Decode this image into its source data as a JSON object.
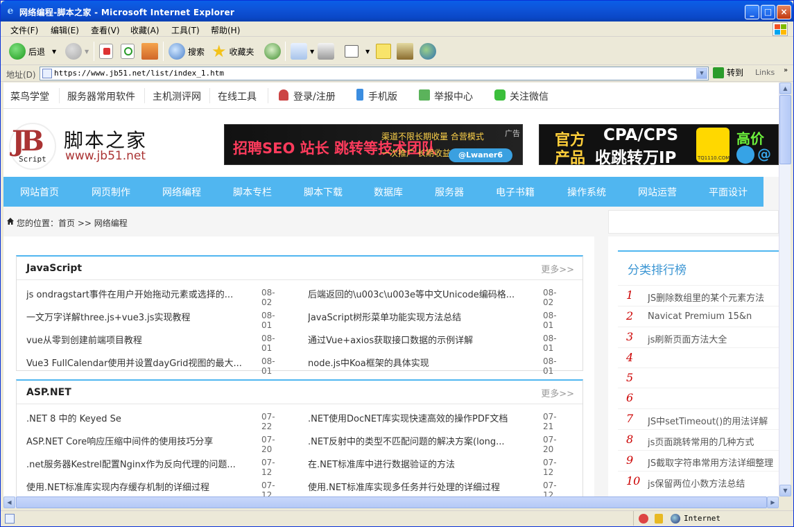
{
  "window": {
    "title": "网络编程-脚本之家 - Microsoft Internet Explorer"
  },
  "menu": [
    "文件(F)",
    "编辑(E)",
    "查看(V)",
    "收藏(A)",
    "工具(T)",
    "帮助(H)"
  ],
  "toolbar": {
    "back": "后退",
    "search": "搜索",
    "favorites": "收藏夹"
  },
  "address": {
    "label": "地址(D)",
    "url": "https://www.jb51.net/list/index_1.htm",
    "go": "转到",
    "links": "Links"
  },
  "status": {
    "zone": "Internet"
  },
  "page": {
    "topnav": [
      "菜鸟学堂",
      "服务器常用软件",
      "主机测评网",
      "在线工具",
      "登录/注册",
      "手机版",
      "举报中心",
      "关注微信"
    ],
    "logo": {
      "cn": "脚本之家",
      "url": "www.jb51.net",
      "mark": "JB",
      "script": "Script"
    },
    "ad1": {
      "headline": "招聘SEO 站长 跳转等技术团队",
      "line1": "渠道不限长期收量 合营模式",
      "line2": "一次推广 长期收益",
      "tag": "广告",
      "handle": "@Lwaner6"
    },
    "ad2": {
      "word1": "官方",
      "word2": "产品",
      "cpa": "CPA/CPS",
      "ip": "收跳转万IP",
      "brand": "TQ1110.COM",
      "high": "高价",
      "at": "@"
    },
    "mainnav": [
      "网站首页",
      "网页制作",
      "网络编程",
      "脚本专栏",
      "脚本下载",
      "数据库",
      "服务器",
      "电子书籍",
      "操作系统",
      "网站运营",
      "平面设计"
    ],
    "breadcrumb": "您的位置：首页 >> 网络编程",
    "panels": [
      {
        "title": "JavaScript",
        "more": "更多>>",
        "rows": [
          [
            "js ondragstart事件在用户开始拖动元素或选择的...",
            "08-02",
            "后端返回的\\u003c\\u003e等中文Unicode编码格...",
            "08-02"
          ],
          [
            "一文万字详解three.js+vue3.js实现教程",
            "08-01",
            "JavaScript树形菜单功能实现方法总结",
            "08-01"
          ],
          [
            "vue从零到创建前端项目教程",
            "08-01",
            "通过Vue+axios获取接口数据的示例详解",
            "08-01"
          ],
          [
            "Vue3 FullCalendar使用并设置dayGrid视图的最大...",
            "08-01",
            "node.js中Koa框架的具体实现",
            "08-01"
          ]
        ]
      },
      {
        "title": "ASP.NET",
        "more": "更多>>",
        "rows": [
          [
            ".NET 8 中的 Keyed Se",
            "07-22",
            ".NET使用DocNET库实现快速高效的操作PDF文档",
            "07-21"
          ],
          [
            "ASP.NET Core响应压缩中间件的使用技巧分享",
            "07-20",
            ".NET反射中的类型不匹配问题的解决方案(long...",
            "07-20"
          ],
          [
            ".net服务器Kestrel配置Nginx作为反向代理的问题...",
            "07-12",
            "在.NET标准库中进行数据验证的方法",
            "07-12"
          ],
          [
            "使用.NET标准库实现内存缓存机制的详细过程",
            "07-12",
            "使用.NET标准库实现多任务并行处理的详细过程",
            "07-12"
          ]
        ]
      }
    ],
    "rank": {
      "title": "分类排行榜",
      "items": [
        {
          "n": "1",
          "t": "JS删除数组里的某个元素方法"
        },
        {
          "n": "2",
          "t": "Navicat Premium 15&n"
        },
        {
          "n": "3",
          "t": "js刷新页面方法大全"
        },
        {
          "n": "4",
          "t": ""
        },
        {
          "n": "5",
          "t": ""
        },
        {
          "n": "6",
          "t": ""
        },
        {
          "n": "7",
          "t": "JS中setTimeout()的用法详解"
        },
        {
          "n": "8",
          "t": "js页面跳转常用的几种方式"
        },
        {
          "n": "9",
          "t": "JS截取字符串常用方法详细整理"
        },
        {
          "n": "10",
          "t": "js保留两位小数方法总结"
        }
      ]
    }
  }
}
